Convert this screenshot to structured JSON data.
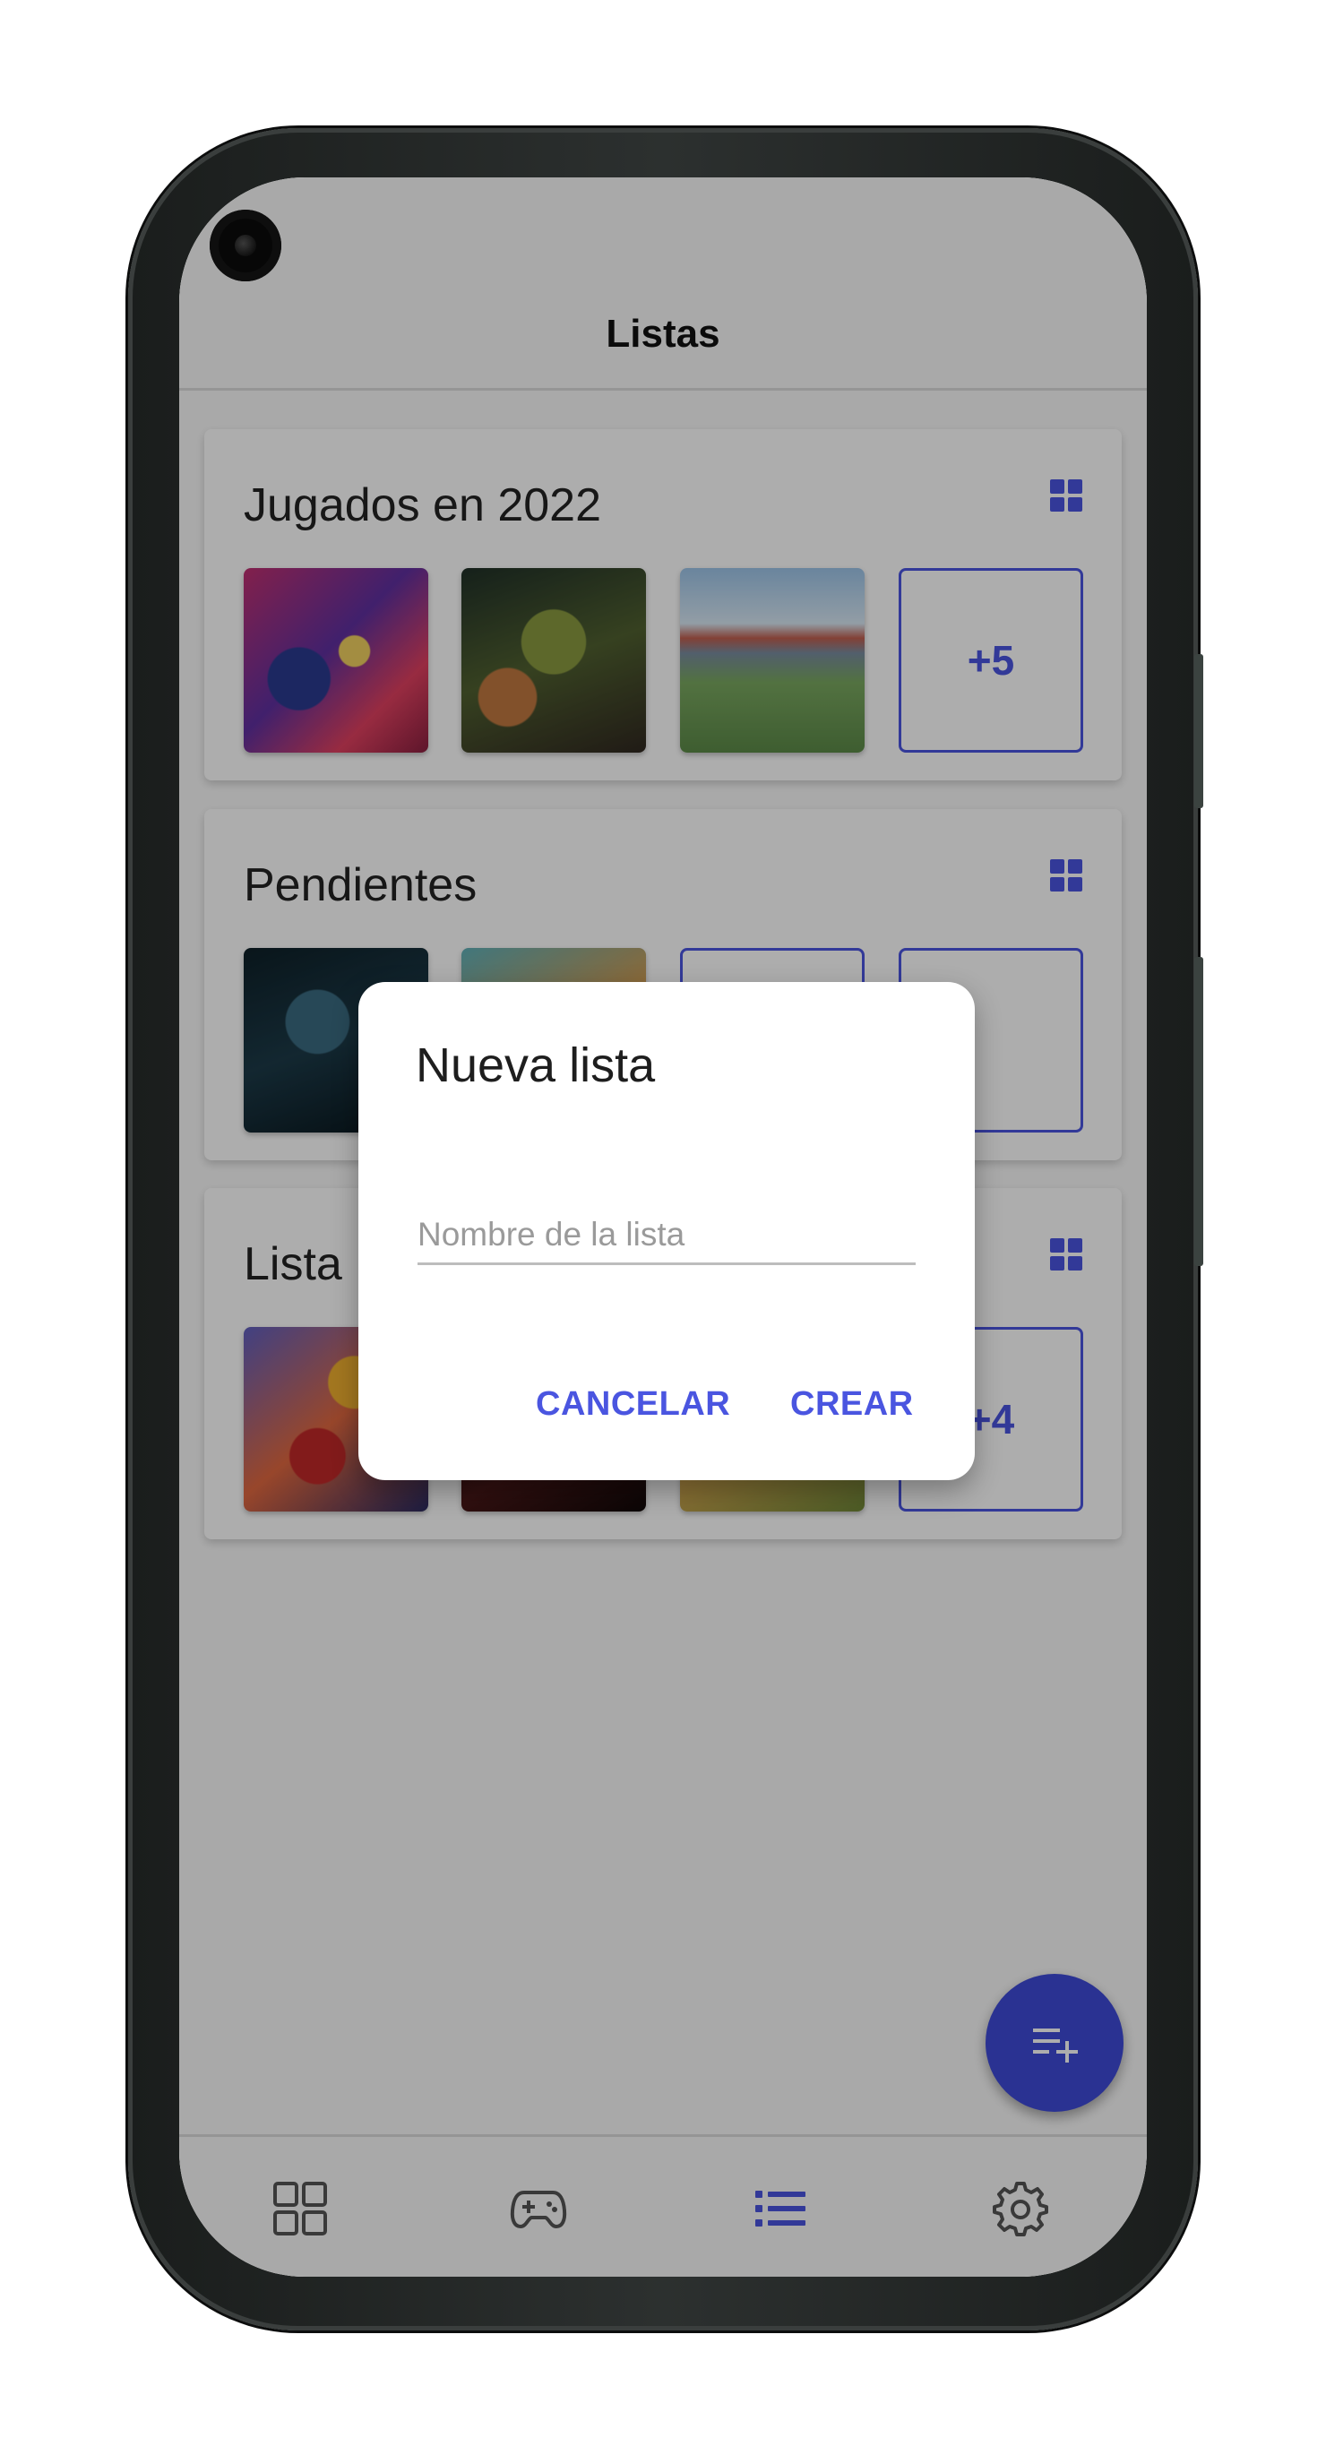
{
  "app": {
    "title": "Listas"
  },
  "lists": [
    {
      "name": "Jugados en 2022",
      "more": "+5"
    },
    {
      "name": "Pendientes",
      "more": ""
    },
    {
      "name": "Lista",
      "more": "+4"
    }
  ],
  "dialog": {
    "title": "Nueva lista",
    "input_placeholder": "Nombre de la lista",
    "input_value": "",
    "cancel_label": "CANCELAR",
    "create_label": "CREAR"
  },
  "bottom_nav": {
    "items": [
      {
        "icon": "grid-icon",
        "selected": false
      },
      {
        "icon": "gamepad-icon",
        "selected": false
      },
      {
        "icon": "list-icon",
        "selected": true
      },
      {
        "icon": "gear-icon",
        "selected": false
      }
    ]
  },
  "fab": {
    "icon": "playlist-add-icon"
  },
  "colors": {
    "accent": "#4a55e0",
    "fab": "#3f4ad8",
    "scrim": "rgba(0,0,0,0.32)",
    "inactive_icon": "#555555"
  }
}
